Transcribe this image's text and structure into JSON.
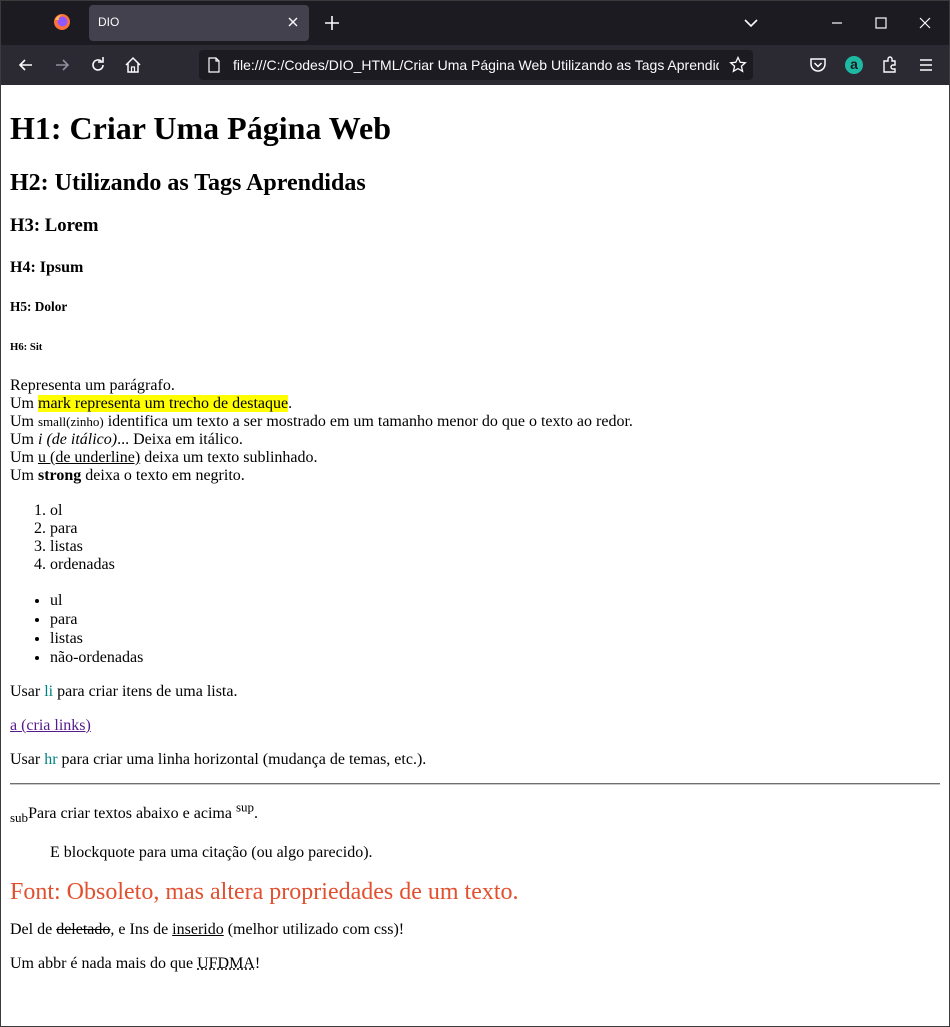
{
  "browser": {
    "tab_title": "DIO",
    "url": "file:///C:/Codes/DIO_HTML/Criar Uma Página Web Utilizando as Tags Aprendidas.html",
    "extension_badge": "a",
    "colors": {
      "tabbar": "#1c1b22",
      "active_tab": "#42414d",
      "navbar": "#2b2a33",
      "ext_accent": "#1db9a2"
    }
  },
  "page": {
    "h1": "H1: Criar Uma Página Web",
    "h2": "H2: Utilizando as Tags Aprendidas",
    "h3": "H3: Lorem",
    "h4": "H4: Ipsum",
    "h5": "H5: Dolor",
    "h6": "H6: Sit",
    "paragraph": {
      "line1": "Representa um parágrafo.",
      "line2_pre": "Um ",
      "line2_mark": "mark representa um trecho de destaque",
      "line2_post": ".",
      "line3_pre": "Um ",
      "line3_small": "small(zinho)",
      "line3_post": " identifica um texto a ser mostrado em um tamanho menor do que o texto ao redor.",
      "line4_pre": "Um ",
      "line4_italic": "i (de itálico)",
      "line4_post": "... Deixa em itálico.",
      "line5_pre": "Um ",
      "line5_underline": "u (de underline)",
      "line5_post": " deixa um texto sublinhado.",
      "line6_pre": "Um ",
      "line6_strong": "strong",
      "line6_post": " deixa o texto em negrito."
    },
    "ordered_list": [
      "ol",
      "para",
      "listas",
      "ordenadas"
    ],
    "unordered_list": [
      "ul",
      "para",
      "listas",
      "não-ordenadas"
    ],
    "li_para": {
      "pre": "Usar ",
      "tag": "li",
      "post": " para criar itens de uma lista."
    },
    "link_text": "a (cria links)",
    "hr_para": {
      "pre": "Usar ",
      "tag": "hr",
      "post": " para criar uma linha horizontal (mudança de temas, etc.)."
    },
    "sub_para": {
      "sub": "sub",
      "mid": "Para criar textos abaixo e acima ",
      "sup": "sup",
      "post": "."
    },
    "blockquote": "E blockquote para uma citação (ou algo parecido).",
    "font_text": "Font: Obsoleto, mas altera propriedades de um texto.",
    "del_para": {
      "pre": "Del de ",
      "del": "deletado",
      "mid": ", e Ins de ",
      "ins": "inserido",
      "post": " (melhor utilizado com css)!"
    },
    "abbr_para": {
      "pre": "Um abbr é nada mais do que ",
      "abbr": "UFDMA",
      "post": "!"
    },
    "colors": {
      "mark": "#ffff00",
      "teal": "#008080",
      "font_red": "#e25030",
      "visited_link": "#551a8b"
    }
  }
}
